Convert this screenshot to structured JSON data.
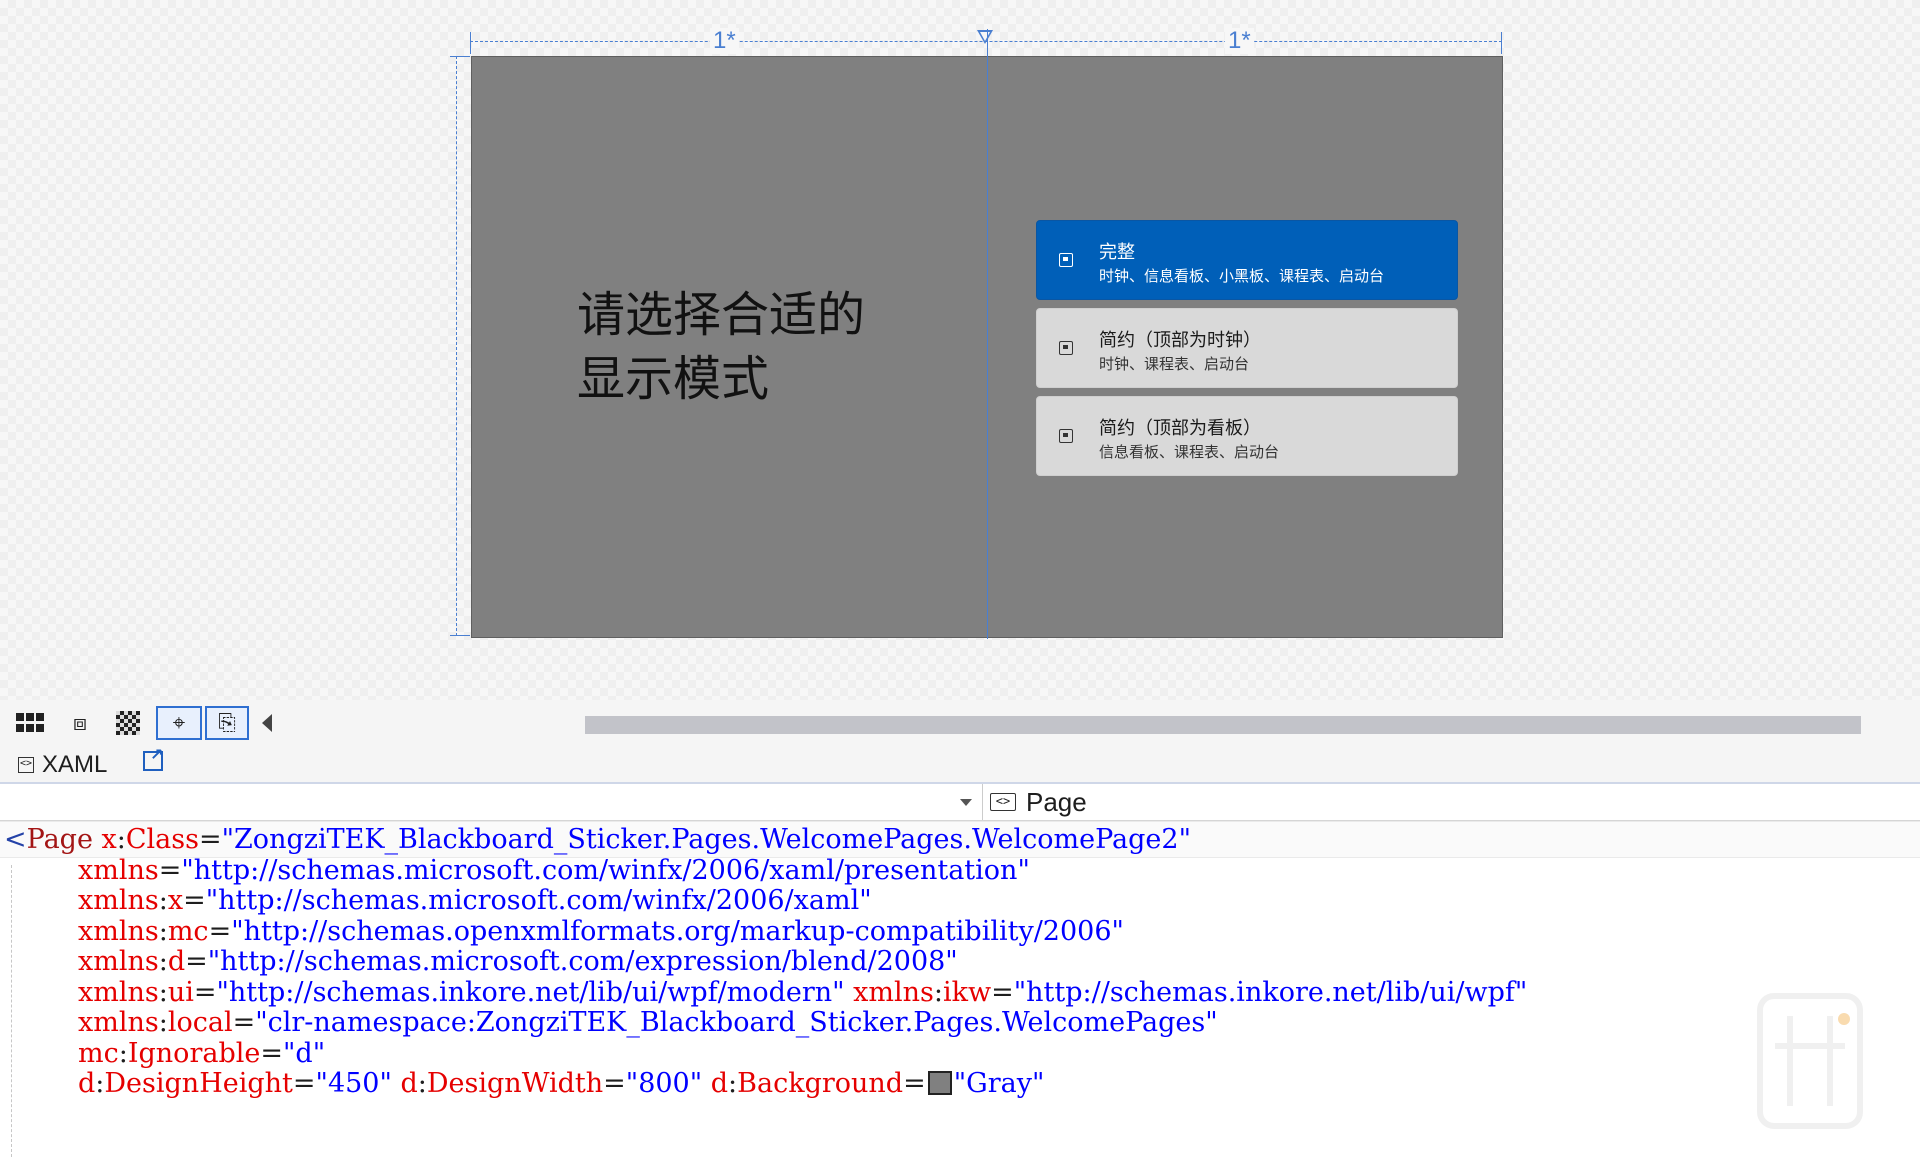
{
  "designer": {
    "column_ruler": {
      "left_star": "1*",
      "right_star": "1*"
    },
    "page_preview": {
      "title": "请选择合适的\n显示模式",
      "modes": [
        {
          "name": "完整",
          "description": "时钟、信息看板、小黑板、课程表、启动台",
          "selected": true,
          "icon": "full-layout-icon"
        },
        {
          "name": "简约（顶部为时钟）",
          "description": "时钟、课程表、启动台",
          "selected": false,
          "icon": "clock-widget-icon"
        },
        {
          "name": "简约（顶部为看板）",
          "description": "信息看板、课程表、启动台",
          "selected": false,
          "icon": "board-widget-icon"
        }
      ],
      "background": "#808080",
      "accent": "#005fb8"
    }
  },
  "zoom_toolbar": {
    "tools": [
      "grid-icon",
      "snap-grid-icon",
      "checkerboard-icon",
      "snap-lines-icon",
      "artboard-icon"
    ],
    "active_tools": [
      "snap-lines-icon",
      "artboard-icon"
    ]
  },
  "tabs": {
    "xaml_label": "XAML",
    "xaml_icon": "xaml-icon",
    "popout_icon": "popout-icon"
  },
  "nav": {
    "left_value": "",
    "right_value": "Page",
    "right_icon": "element-icon"
  },
  "code": {
    "lines": [
      {
        "open": "<",
        "tag": "Page",
        "attrs": [
          {
            "ns": "x",
            "name": "Class",
            "value": "ZongziTEK_Blackboard_Sticker.Pages.WelcomePages.WelcomePage2"
          }
        ]
      },
      {
        "attrs": [
          {
            "ns": "",
            "name": "xmlns",
            "value": "http://schemas.microsoft.com/winfx/2006/xaml/presentation"
          }
        ]
      },
      {
        "attrs": [
          {
            "ns": "xmlns",
            "name": "x",
            "value": "http://schemas.microsoft.com/winfx/2006/xaml"
          }
        ]
      },
      {
        "attrs": [
          {
            "ns": "xmlns",
            "name": "mc",
            "value": "http://schemas.openxmlformats.org/markup-compatibility/2006"
          }
        ]
      },
      {
        "attrs": [
          {
            "ns": "xmlns",
            "name": "d",
            "value": "http://schemas.microsoft.com/expression/blend/2008"
          }
        ]
      },
      {
        "attrs": [
          {
            "ns": "xmlns",
            "name": "ui",
            "value": "http://schemas.inkore.net/lib/ui/wpf/modern"
          },
          {
            "ns": "xmlns",
            "name": "ikw",
            "value": "http://schemas.inkore.net/lib/ui/wpf"
          }
        ]
      },
      {
        "attrs": [
          {
            "ns": "xmlns",
            "name": "local",
            "value": "clr-namespace:ZongziTEK_Blackboard_Sticker.Pages.WelcomePages"
          }
        ]
      },
      {
        "attrs": [
          {
            "ns": "mc",
            "name": "Ignorable",
            "value": "d"
          }
        ]
      },
      {
        "attrs": [
          {
            "ns": "d",
            "name": "DesignHeight",
            "value": "450"
          },
          {
            "ns": "d",
            "name": "DesignWidth",
            "value": "800"
          },
          {
            "ns": "d",
            "name": "Background",
            "value": "Gray",
            "swatch": "#808080"
          }
        ]
      }
    ]
  }
}
